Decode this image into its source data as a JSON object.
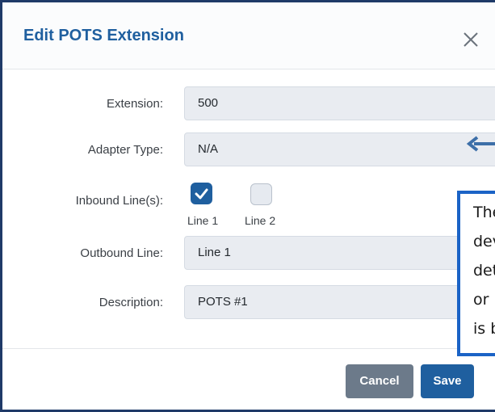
{
  "dialog": {
    "title": "Edit POTS Extension",
    "close_icon": "close-icon"
  },
  "form": {
    "extension": {
      "label": "Extension:",
      "value": "500"
    },
    "adapter_type": {
      "label": "Adapter Type:",
      "value": "N/A"
    },
    "inbound_lines": {
      "label": "Inbound Line(s):",
      "options": [
        {
          "label": "Line 1",
          "checked": true
        },
        {
          "label": "Line 2",
          "checked": false
        }
      ]
    },
    "outbound_line": {
      "label": "Outbound Line:",
      "value": "Line 1"
    },
    "description": {
      "label": "Description:",
      "value": "POTS #1"
    }
  },
  "footer": {
    "cancel_label": "Cancel",
    "save_label": "Save"
  },
  "callout": {
    "lines": [
      "The",
      "devi",
      "dete",
      "or FX",
      "is be"
    ],
    "border_color": "#1b63c6"
  },
  "colors": {
    "accent": "#1f5f9f",
    "cancel": "#6c7a8a",
    "frame_border": "#1f3a68",
    "field_bg": "#e9ecf1"
  }
}
